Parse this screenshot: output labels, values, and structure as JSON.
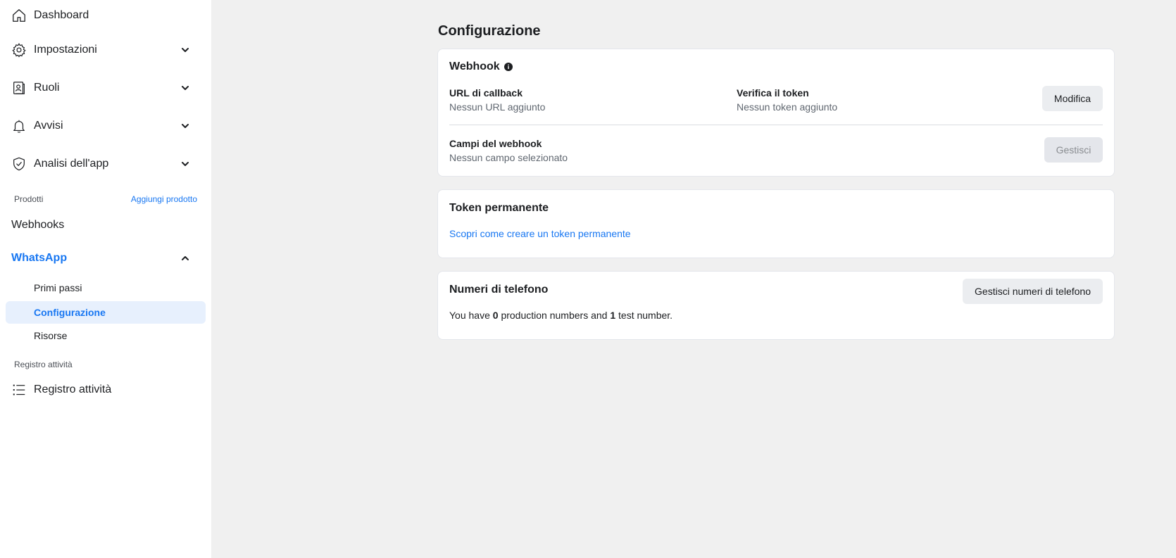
{
  "sidebar": {
    "dashboard": {
      "label": "Dashboard",
      "icon": "home-icon"
    },
    "impostazioni": {
      "label": "Impostazioni",
      "icon": "gear-icon"
    },
    "ruoli": {
      "label": "Ruoli",
      "icon": "roles-icon"
    },
    "avvisi": {
      "label": "Avvisi",
      "icon": "bell-icon"
    },
    "analisi": {
      "label": "Analisi dell'app",
      "icon": "shield-check-icon"
    },
    "products_header": "Prodotti",
    "add_product": "Aggiungi prodotto",
    "webhooks": "Webhooks",
    "whatsapp": "WhatsApp",
    "whatsapp_items": {
      "primi_passi": "Primi passi",
      "configurazione": "Configurazione",
      "risorse": "Risorse"
    },
    "activity_header": "Registro attività",
    "activity_item": {
      "label": "Registro attività",
      "icon": "list-icon"
    },
    "accent_color": "#1877f2"
  },
  "main": {
    "title": "Configurazione",
    "webhook": {
      "title": "Webhook",
      "callback_label": "URL di callback",
      "callback_value": "Nessun URL aggiunto",
      "token_label": "Verifica il token",
      "token_value": "Nessun token aggiunto",
      "edit_button": "Modifica",
      "fields_label": "Campi del webhook",
      "fields_value": "Nessun campo selezionato",
      "manage_button": "Gestisci"
    },
    "permanent_token": {
      "title": "Token permanente",
      "link": "Scopri come creare un token permanente"
    },
    "phone_numbers": {
      "title": "Numeri di telefono",
      "manage_button": "Gestisci numeri di telefono",
      "text_prefix": "You have ",
      "production_count": "0",
      "text_middle": " production numbers and ",
      "test_count": "1",
      "text_suffix": " test number."
    }
  }
}
